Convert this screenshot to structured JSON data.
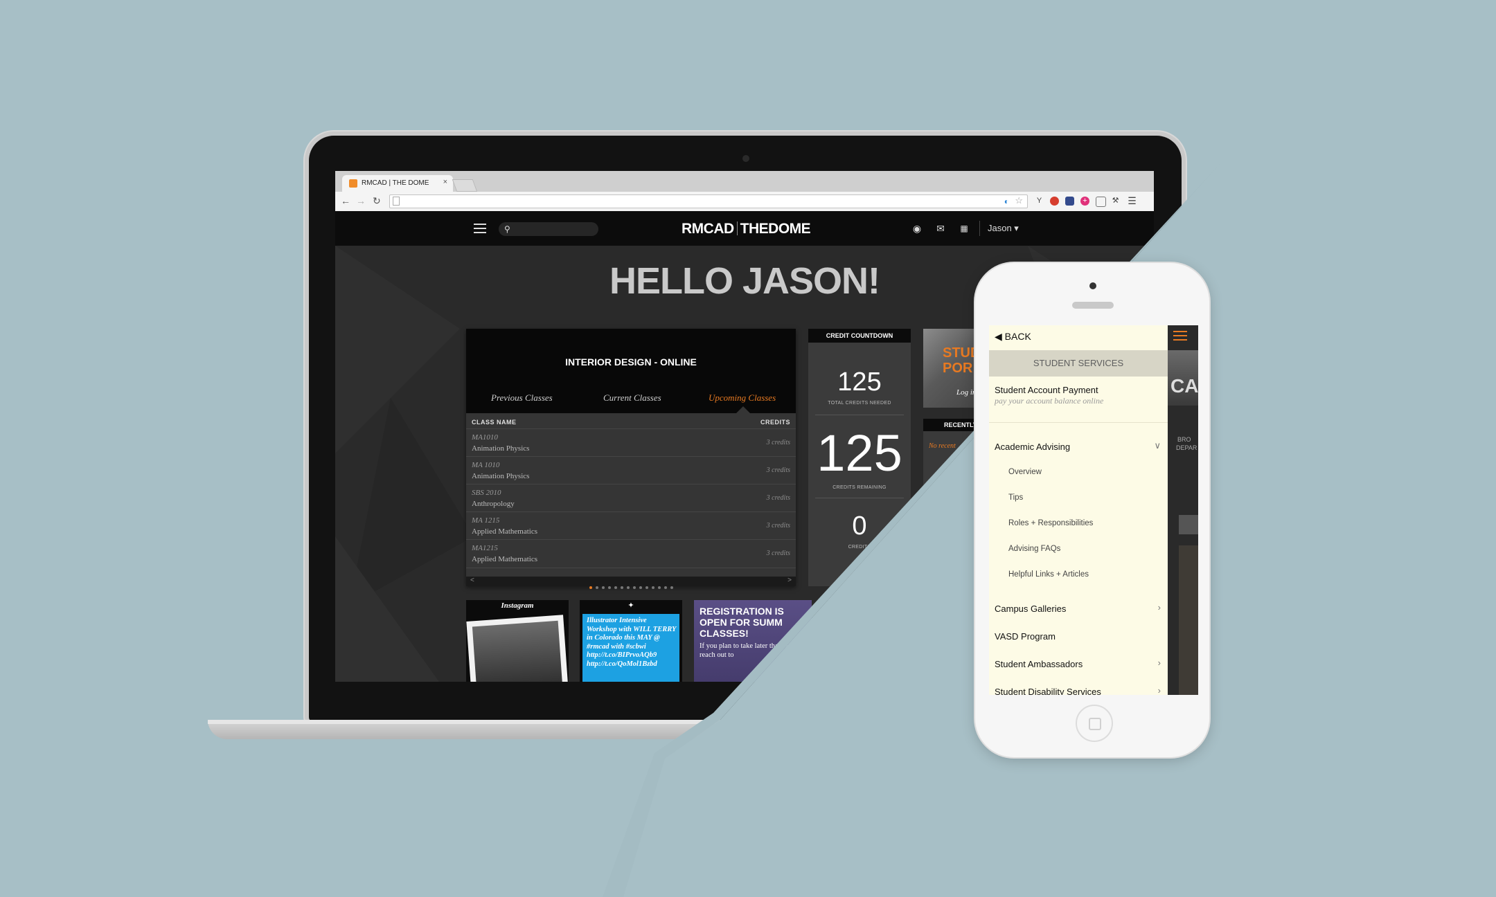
{
  "browser": {
    "tab_title": "RMCAD | THE DOME",
    "tab_close": "×",
    "ext_y": "Y"
  },
  "header": {
    "logo_left": "RMCAD",
    "logo_right": "THEDOME",
    "user": "Jason ▾"
  },
  "greeting": "HELLO JASON!",
  "classes": {
    "title": "INTERIOR DESIGN - ONLINE",
    "tabs": [
      "Previous Classes",
      "Current Classes",
      "Upcoming Classes"
    ],
    "col_name": "CLASS NAME",
    "col_credits": "CREDITS",
    "rows": [
      {
        "code": "MA1010",
        "name": "Animation Physics",
        "credits": "3 credits"
      },
      {
        "code": "MA 1010",
        "name": "Animation Physics",
        "credits": "3 credits"
      },
      {
        "code": "SBS 2010",
        "name": "Anthropology",
        "credits": "3 credits"
      },
      {
        "code": "MA 1215",
        "name": "Applied Mathematics",
        "credits": "3 credits"
      },
      {
        "code": "MA1215",
        "name": "Applied Mathematics",
        "credits": "3 credits"
      }
    ],
    "prev_arrow": "<",
    "next_arrow": ">"
  },
  "credit_countdown": {
    "title": "CREDIT COUNTDOWN",
    "needed": "125",
    "needed_label": "TOTAL CREDITS NEEDED",
    "remaining": "125",
    "remaining_label": "CREDITS REMAINING",
    "completed": "0",
    "completed_label": "CREDITS"
  },
  "tiles": {
    "portal_title": "STUD POR",
    "portal_sub": "Log in",
    "recent_title": "RECENTLY",
    "recent_body": "No recent",
    "instagram": "Instagram",
    "twitter_text": "Illustrator Intensive Workshop with WILL TERRY in Colorado this MAY @ #rmcad with #scbwi http://t.co/BIPrvoAQb9 http://t.co/QoMol1Bzbd",
    "registration_title": "REGISTRATION IS OPEN FOR SUMM CLASSES!",
    "registration_body": "If you plan to take later than April reach out to"
  },
  "phone_menu": {
    "back": "BACK",
    "section": "STUDENT SERVICES",
    "account_payment": "Student Account Payment",
    "account_payment_sub": "pay your account balance online",
    "academic_advising": "Academic Advising",
    "sub_items": [
      "Overview",
      "Tips",
      "Roles + Responsibilities",
      "Advising FAQs",
      "Helpful Links + Articles"
    ],
    "campus_galleries": "Campus Galleries",
    "vasd": "VASD Program",
    "ambassadors": "Student Ambassadors",
    "disability": "Student Disability Services",
    "bg_text_1": "CA",
    "bg_text_2": "BRO",
    "bg_text_3": "DEPAR"
  },
  "colors": {
    "background": "#a7bfc6",
    "accent": "#e87a22",
    "twitter": "#1da1e2",
    "registration": "#5a4f86",
    "menu_bg": "#fdfbe6"
  }
}
